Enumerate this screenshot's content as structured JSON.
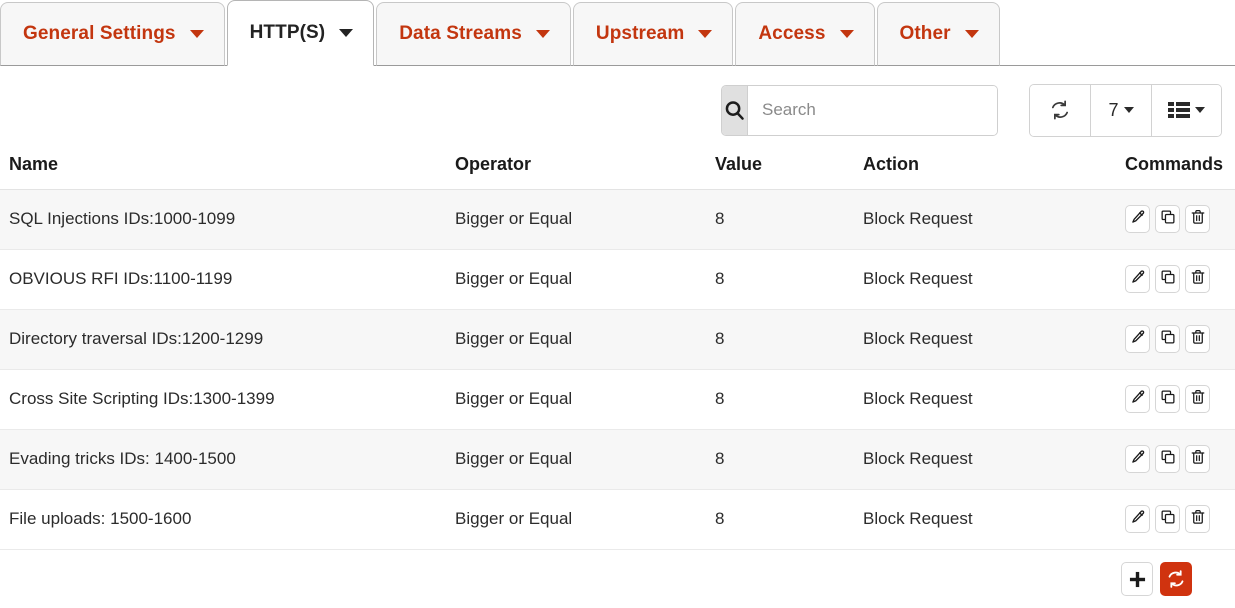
{
  "tabs": [
    {
      "label": "General Settings",
      "active": false,
      "icon": "chevron-down-icon"
    },
    {
      "label": "HTTP(S)",
      "active": true,
      "icon": "chevron-down-icon"
    },
    {
      "label": "Data Streams",
      "active": false,
      "icon": "chevron-down-icon"
    },
    {
      "label": "Upstream",
      "active": false,
      "icon": "chevron-down-icon"
    },
    {
      "label": "Access",
      "active": false,
      "icon": "chevron-down-icon"
    },
    {
      "label": "Other",
      "active": false,
      "icon": "chevron-down-icon"
    }
  ],
  "toolbar": {
    "search": {
      "icon": "search-icon",
      "value": "",
      "placeholder": "Search"
    },
    "refresh_icon": "refresh-icon",
    "page_size": "7",
    "columns_icon": "list-columns-icon"
  },
  "table": {
    "columns": [
      "Name",
      "Operator",
      "Value",
      "Action",
      "Commands"
    ],
    "row_commands": [
      "edit-icon",
      "copy-icon",
      "delete-icon"
    ],
    "rows": [
      {
        "name": "SQL Injections IDs:1000-1099",
        "operator": "Bigger or Equal",
        "value": "8",
        "action": "Block Request"
      },
      {
        "name": "OBVIOUS RFI IDs:1100-1199",
        "operator": "Bigger or Equal",
        "value": "8",
        "action": "Block Request"
      },
      {
        "name": "Directory traversal IDs:1200-1299",
        "operator": "Bigger or Equal",
        "value": "8",
        "action": "Block Request"
      },
      {
        "name": "Cross Site Scripting IDs:1300-1399",
        "operator": "Bigger or Equal",
        "value": "8",
        "action": "Block Request"
      },
      {
        "name": "Evading tricks IDs: 1400-1500",
        "operator": "Bigger or Equal",
        "value": "8",
        "action": "Block Request"
      },
      {
        "name": "File uploads: 1500-1600",
        "operator": "Bigger or Equal",
        "value": "8",
        "action": "Block Request"
      }
    ]
  },
  "footer": {
    "add_icon": "plus-icon",
    "sync_icon": "sync-icon"
  },
  "colors": {
    "tab_accent": "#c3360f",
    "sync_button": "#d0330f",
    "row_stripe": "#f7f7f7",
    "tab_inactive_bg": "#f7f7f7"
  }
}
